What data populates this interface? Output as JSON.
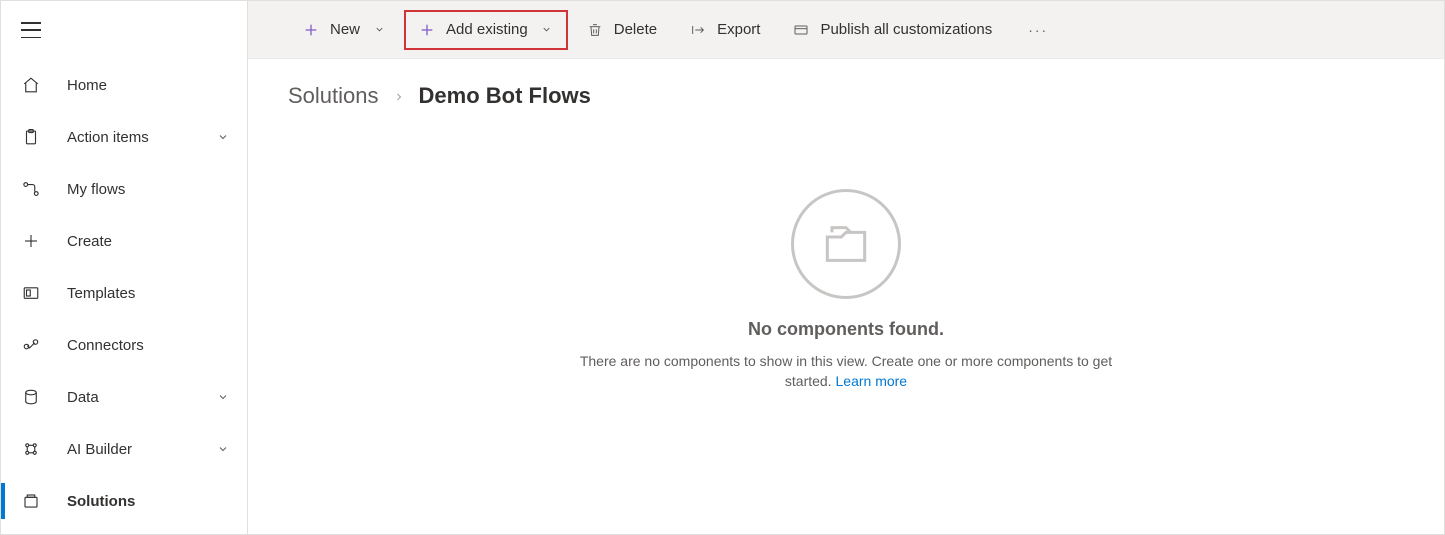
{
  "sidebar": {
    "items": [
      {
        "label": "Home",
        "icon": "home-icon",
        "expandable": false,
        "selected": false
      },
      {
        "label": "Action items",
        "icon": "clipboard-icon",
        "expandable": true,
        "selected": false
      },
      {
        "label": "My flows",
        "icon": "flow-icon",
        "expandable": false,
        "selected": false
      },
      {
        "label": "Create",
        "icon": "plus-icon",
        "expandable": false,
        "selected": false
      },
      {
        "label": "Templates",
        "icon": "template-icon",
        "expandable": false,
        "selected": false
      },
      {
        "label": "Connectors",
        "icon": "connector-icon",
        "expandable": false,
        "selected": false
      },
      {
        "label": "Data",
        "icon": "database-icon",
        "expandable": true,
        "selected": false
      },
      {
        "label": "AI Builder",
        "icon": "ai-icon",
        "expandable": true,
        "selected": false
      },
      {
        "label": "Solutions",
        "icon": "solution-icon",
        "expandable": false,
        "selected": true
      }
    ]
  },
  "commandbar": {
    "new": {
      "label": "New"
    },
    "add_existing": {
      "label": "Add existing"
    },
    "delete": {
      "label": "Delete"
    },
    "export": {
      "label": "Export"
    },
    "publish": {
      "label": "Publish all customizations"
    }
  },
  "breadcrumb": {
    "root": "Solutions",
    "current": "Demo Bot Flows"
  },
  "empty_state": {
    "title": "No components found.",
    "description": "There are no components to show in this view. Create one or more components to get started. ",
    "link_text": "Learn more"
  }
}
